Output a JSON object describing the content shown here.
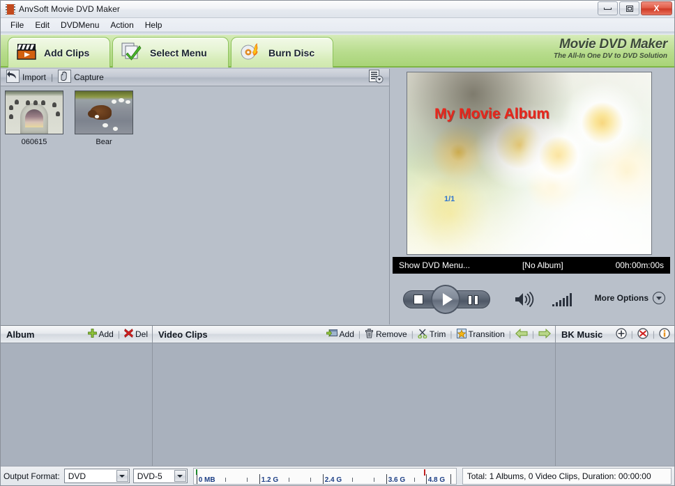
{
  "window": {
    "title": "AnvSoft Movie DVD Maker",
    "icon": "film-reel-icon",
    "controls": [
      {
        "name": "minimize-button",
        "glyph": "minimize-icon"
      },
      {
        "name": "maximize-button",
        "glyph": "maximize-icon"
      },
      {
        "name": "close-button",
        "glyph": "close-icon",
        "label": "X"
      }
    ]
  },
  "menubar": {
    "items": [
      {
        "label": "File"
      },
      {
        "label": "Edit"
      },
      {
        "label": "DVDMenu"
      },
      {
        "label": "Action"
      },
      {
        "label": "Help"
      }
    ]
  },
  "toolbar": {
    "tabs": [
      {
        "label": "Add Clips",
        "icon": "clapperboard-icon",
        "active": true
      },
      {
        "label": "Select Menu",
        "icon": "checkmark-pages-icon",
        "active": false
      },
      {
        "label": "Burn Disc",
        "icon": "burning-disc-icon",
        "active": false
      }
    ],
    "brand_title": "Movie DVD Maker",
    "brand_subtitle": "The All-In One DV to DVD Solution"
  },
  "clip_panel": {
    "import_label": "Import",
    "import_icon": "import-arrow-icon",
    "capture_label": "Capture",
    "capture_icon": "hand-capture-icon",
    "separator": "|",
    "view_options_icon": "list-view-options-icon",
    "thumbnails": [
      {
        "caption": "060615",
        "art": "castle"
      },
      {
        "caption": "Bear",
        "art": "bear"
      }
    ]
  },
  "preview": {
    "menu_title": "My Movie Album",
    "page_indicator": "1/1",
    "status_left": "Show DVD Menu...",
    "status_middle": "[No Album]",
    "status_right": "00h:00m:00s",
    "controls": {
      "stop_icon": "stop-icon",
      "play_icon": "play-icon",
      "pause_icon": "pause-icon",
      "volume_icon": "speaker-icon",
      "equalizer_icon": "equalizer-icon",
      "more_options_label": "More Options",
      "more_options_icon": "chevron-down-circle-icon"
    }
  },
  "panels": {
    "album": {
      "title": "Album",
      "buttons": [
        {
          "label": "Add",
          "icon": "plus-green-icon"
        },
        {
          "label": "Del",
          "icon": "x-red-icon"
        }
      ]
    },
    "video_clips": {
      "title": "Video Clips",
      "buttons": [
        {
          "label": "Add",
          "icon": "add-clip-icon"
        },
        {
          "label": "Remove",
          "icon": "trash-icon"
        },
        {
          "label": "Trim",
          "icon": "scissors-icon"
        },
        {
          "label": "Transition",
          "icon": "transition-star-icon"
        }
      ],
      "nav": [
        {
          "label": "",
          "icon": "arrow-left-icon"
        },
        {
          "label": "",
          "icon": "arrow-right-icon"
        }
      ]
    },
    "bk_music": {
      "title": "BK Music",
      "buttons": [
        {
          "icon": "plus-circle-icon"
        },
        {
          "icon": "x-circle-red-icon"
        },
        {
          "icon": "info-circle-icon"
        }
      ]
    }
  },
  "statusbar": {
    "output_format_label": "Output Format:",
    "format_value": "DVD",
    "disc_value": "DVD-5",
    "ruler": {
      "labels": [
        "0 MB",
        "1.2 G",
        "2.4 G",
        "3.6 G",
        "4.8 G"
      ],
      "start_marker_color": "#1a8a2a",
      "end_marker_color": "#c02020"
    },
    "total_text": "Total: 1 Albums, 0 Video Clips, Duration: 00:00:00"
  }
}
